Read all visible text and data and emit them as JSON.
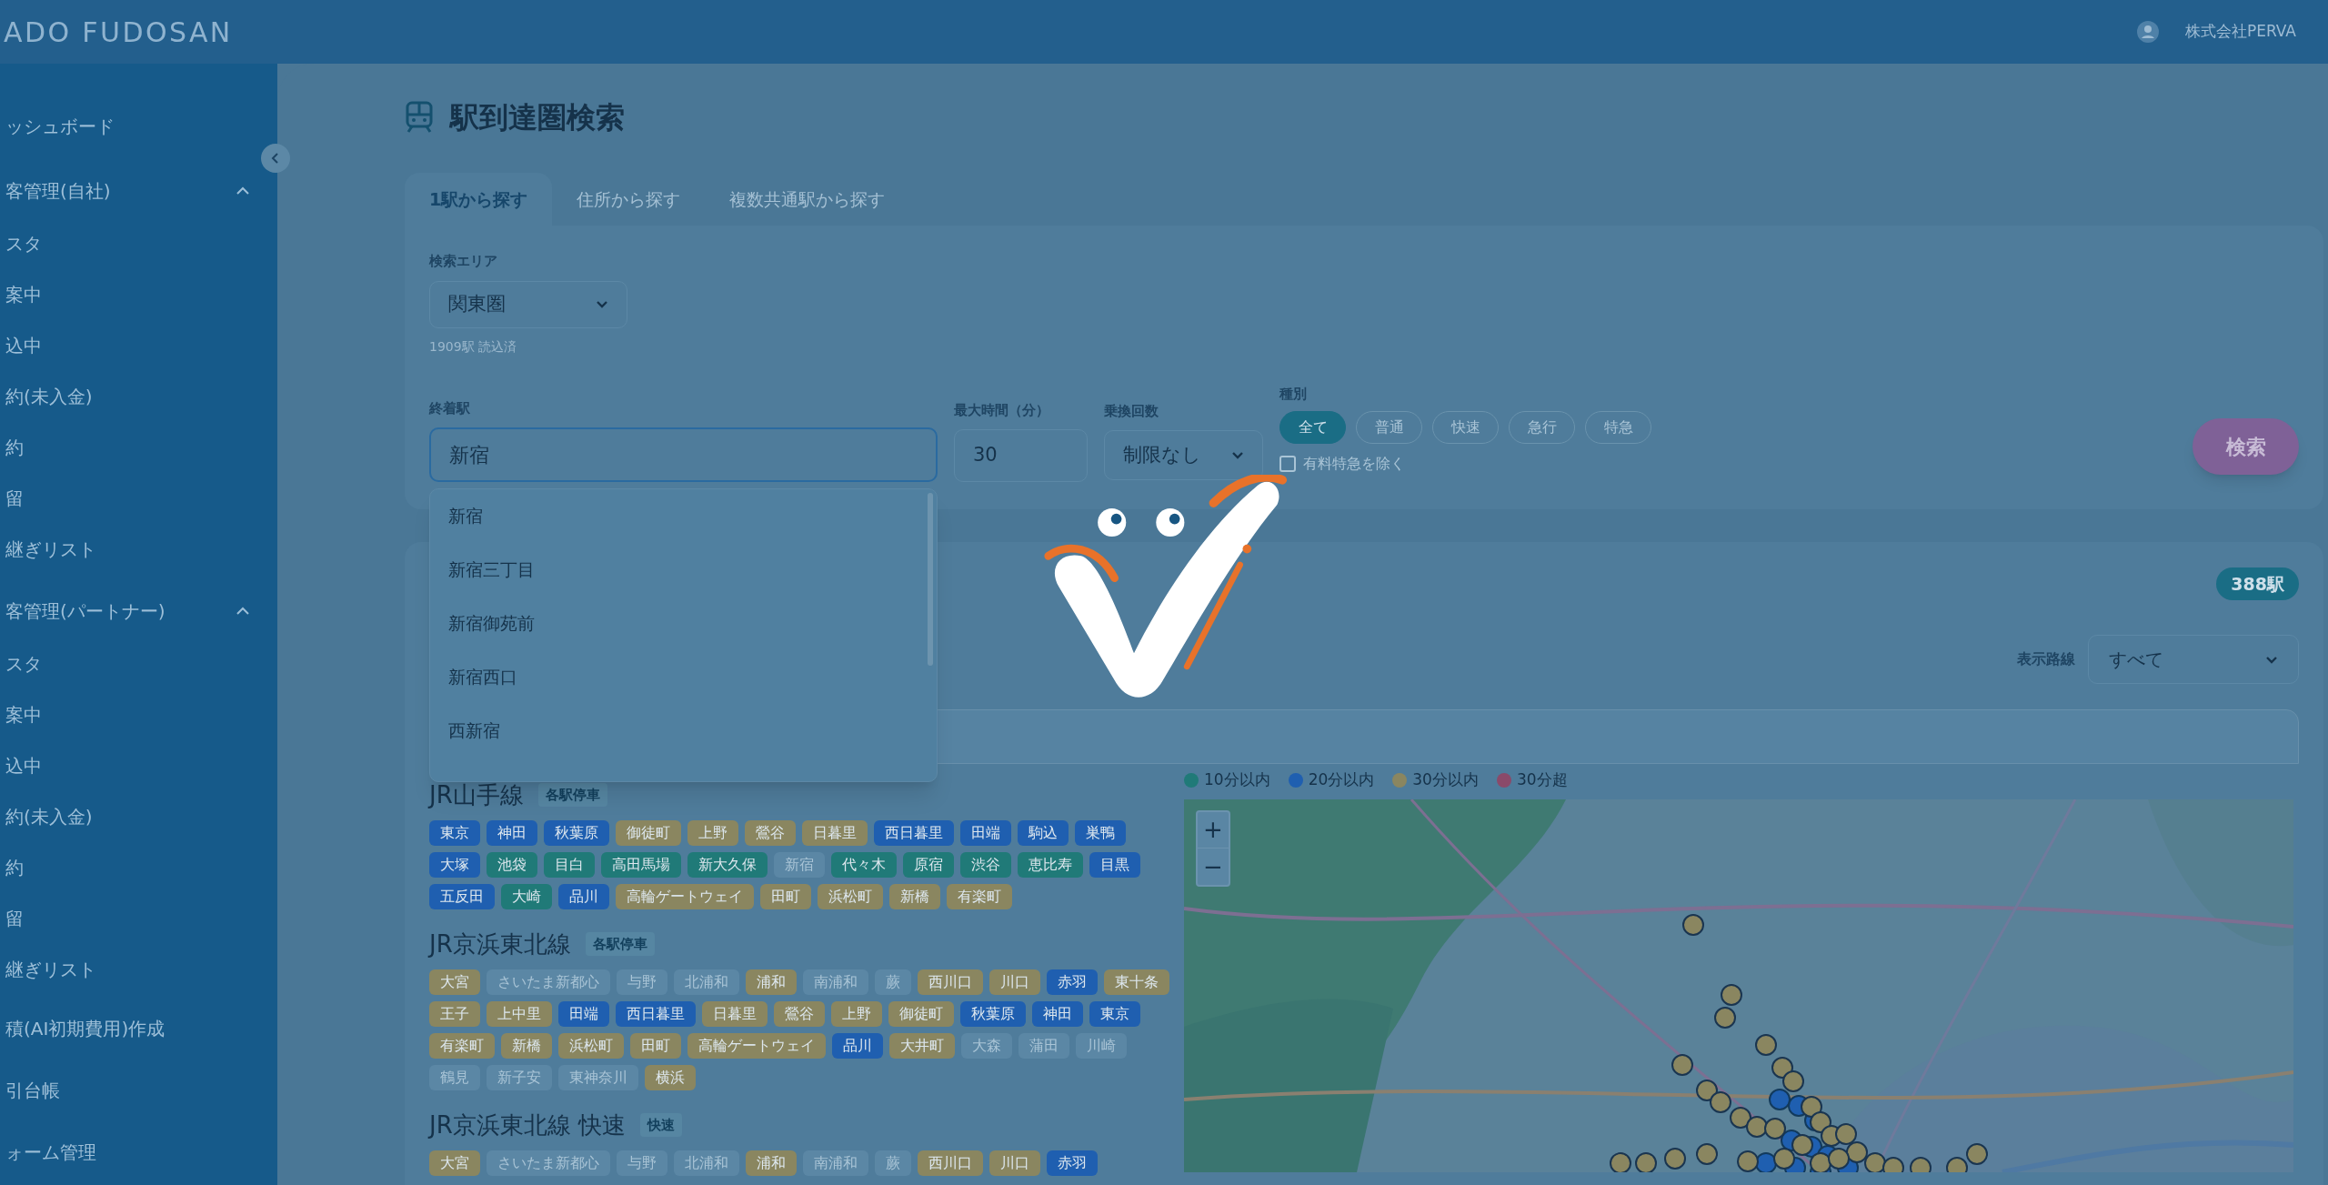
{
  "header": {
    "brand": "ADO FUDOSAN",
    "company": "株式会社PERVA"
  },
  "sidebar": {
    "items": [
      {
        "kind": "link",
        "label": "ッシュボード"
      },
      {
        "kind": "group",
        "label": "客管理(自社)",
        "expanded": true,
        "children": [
          {
            "label": "スタ"
          },
          {
            "label": "案中"
          },
          {
            "label": "込中"
          },
          {
            "label": "約(未入金)"
          },
          {
            "label": "約"
          },
          {
            "label": "留"
          },
          {
            "label": "継ぎリスト"
          }
        ]
      },
      {
        "kind": "group",
        "label": "客管理(パートナー)",
        "expanded": true,
        "children": [
          {
            "label": "スタ"
          },
          {
            "label": "案中"
          },
          {
            "label": "込中"
          },
          {
            "label": "約(未入金)"
          },
          {
            "label": "約"
          },
          {
            "label": "留"
          },
          {
            "label": "継ぎリスト"
          }
        ]
      },
      {
        "kind": "link",
        "label": "積(AI初期費用)作成"
      },
      {
        "kind": "link",
        "label": "引台帳"
      },
      {
        "kind": "link",
        "label": "ォーム管理"
      }
    ]
  },
  "page": {
    "title": "駅到達圏検索",
    "tabs": [
      {
        "label": "1駅から探す",
        "selected": true
      },
      {
        "label": "住所から探す",
        "selected": false
      },
      {
        "label": "複数共通駅から探す",
        "selected": false
      }
    ]
  },
  "search": {
    "area_label": "検索エリア",
    "area_value": "関東圏",
    "loaded_note": "1909駅 読込済",
    "station_label": "終着駅",
    "station_value": "新宿",
    "suggestions": [
      "新宿",
      "新宿三丁目",
      "新宿御苑前",
      "新宿西口",
      "西新宿"
    ],
    "max_time_label": "最大時間（分）",
    "max_time_value": "30",
    "transfers_label": "乗換回数",
    "transfers_value": "制限なし",
    "type_label": "種別",
    "types": [
      {
        "label": "全て",
        "selected": true
      },
      {
        "label": "普通",
        "selected": false
      },
      {
        "label": "快速",
        "selected": false
      },
      {
        "label": "急行",
        "selected": false
      },
      {
        "label": "特急",
        "selected": false
      }
    ],
    "exclude_paid": {
      "label": "有料特急を除く",
      "checked": false
    },
    "search_button": "検索"
  },
  "results": {
    "count": "388駅",
    "line_filter_label": "表示路線",
    "line_filter_value": "すべて",
    "lines": [
      {
        "name": "JR山手線",
        "badge": "各駅停車",
        "stations": [
          {
            "name": "東京",
            "reachable": true,
            "color": "#1f5fb0"
          },
          {
            "name": "神田",
            "reachable": true,
            "color": "#1f5fb0"
          },
          {
            "name": "秋葉原",
            "reachable": true,
            "color": "#1f5fb0"
          },
          {
            "name": "御徒町",
            "reachable": true,
            "color": "#8a8660"
          },
          {
            "name": "上野",
            "reachable": true,
            "color": "#8a8660"
          },
          {
            "name": "鶯谷",
            "reachable": true,
            "color": "#8a8660"
          },
          {
            "name": "日暮里",
            "reachable": true,
            "color": "#8a8660"
          },
          {
            "name": "西日暮里",
            "reachable": true,
            "color": "#1f5fb0"
          },
          {
            "name": "田端",
            "reachable": true,
            "color": "#1f5fb0"
          },
          {
            "name": "駒込",
            "reachable": true,
            "color": "#1f5fb0"
          },
          {
            "name": "巣鴨",
            "reachable": true,
            "color": "#1f5fb0"
          },
          {
            "name": "大塚",
            "reachable": true,
            "color": "#1f5fb0"
          },
          {
            "name": "池袋",
            "reachable": true,
            "color": "#207a78"
          },
          {
            "name": "目白",
            "reachable": true,
            "color": "#207a78"
          },
          {
            "name": "高田馬場",
            "reachable": true,
            "color": "#207a78"
          },
          {
            "name": "新大久保",
            "reachable": true,
            "color": "#207a78"
          },
          {
            "name": "新宿",
            "reachable": false
          },
          {
            "name": "代々木",
            "reachable": true,
            "color": "#207a78"
          },
          {
            "name": "原宿",
            "reachable": true,
            "color": "#207a78"
          },
          {
            "name": "渋谷",
            "reachable": true,
            "color": "#207a78"
          },
          {
            "name": "恵比寿",
            "reachable": true,
            "color": "#207a78"
          },
          {
            "name": "目黒",
            "reachable": true,
            "color": "#1f5fb0"
          },
          {
            "name": "五反田",
            "reachable": true,
            "color": "#1f5fb0"
          },
          {
            "name": "大崎",
            "reachable": true,
            "color": "#207a78"
          },
          {
            "name": "品川",
            "reachable": true,
            "color": "#1f5fb0"
          },
          {
            "name": "高輪ゲートウェイ",
            "reachable": true,
            "color": "#8a8660"
          },
          {
            "name": "田町",
            "reachable": true,
            "color": "#8a8660"
          },
          {
            "name": "浜松町",
            "reachable": true,
            "color": "#8a8660"
          },
          {
            "name": "新橋",
            "reachable": true,
            "color": "#8a8660"
          },
          {
            "name": "有楽町",
            "reachable": true,
            "color": "#8a8660"
          }
        ]
      },
      {
        "name": "JR京浜東北線",
        "badge": "各駅停車",
        "stations": [
          {
            "name": "大宮",
            "reachable": true,
            "color": "#8a8660"
          },
          {
            "name": "さいたま新都心",
            "reachable": false
          },
          {
            "name": "与野",
            "reachable": false
          },
          {
            "name": "北浦和",
            "reachable": false
          },
          {
            "name": "浦和",
            "reachable": true,
            "color": "#8a8660"
          },
          {
            "name": "南浦和",
            "reachable": false
          },
          {
            "name": "蕨",
            "reachable": false
          },
          {
            "name": "西川口",
            "reachable": true,
            "color": "#8a8660"
          },
          {
            "name": "川口",
            "reachable": true,
            "color": "#8a8660"
          },
          {
            "name": "赤羽",
            "reachable": true,
            "color": "#1f5fb0"
          },
          {
            "name": "東十条",
            "reachable": true,
            "color": "#8a8660"
          },
          {
            "name": "王子",
            "reachable": true,
            "color": "#8a8660"
          },
          {
            "name": "上中里",
            "reachable": true,
            "color": "#8a8660"
          },
          {
            "name": "田端",
            "reachable": true,
            "color": "#1f5fb0"
          },
          {
            "name": "西日暮里",
            "reachable": true,
            "color": "#1f5fb0"
          },
          {
            "name": "日暮里",
            "reachable": true,
            "color": "#8a8660"
          },
          {
            "name": "鶯谷",
            "reachable": true,
            "color": "#8a8660"
          },
          {
            "name": "上野",
            "reachable": true,
            "color": "#8a8660"
          },
          {
            "name": "御徒町",
            "reachable": true,
            "color": "#8a8660"
          },
          {
            "name": "秋葉原",
            "reachable": true,
            "color": "#1f5fb0"
          },
          {
            "name": "神田",
            "reachable": true,
            "color": "#1f5fb0"
          },
          {
            "name": "東京",
            "reachable": true,
            "color": "#1f5fb0"
          },
          {
            "name": "有楽町",
            "reachable": true,
            "color": "#8a8660"
          },
          {
            "name": "新橋",
            "reachable": true,
            "color": "#8a8660"
          },
          {
            "name": "浜松町",
            "reachable": true,
            "color": "#8a8660"
          },
          {
            "name": "田町",
            "reachable": true,
            "color": "#8a8660"
          },
          {
            "name": "高輪ゲートウェイ",
            "reachable": true,
            "color": "#8a8660"
          },
          {
            "name": "品川",
            "reachable": true,
            "color": "#1f5fb0"
          },
          {
            "name": "大井町",
            "reachable": true,
            "color": "#8a8660"
          },
          {
            "name": "大森",
            "reachable": false
          },
          {
            "name": "蒲田",
            "reachable": false
          },
          {
            "name": "川崎",
            "reachable": false
          },
          {
            "name": "鶴見",
            "reachable": false
          },
          {
            "name": "新子安",
            "reachable": false
          },
          {
            "name": "東神奈川",
            "reachable": false
          },
          {
            "name": "横浜",
            "reachable": true,
            "color": "#8a8660"
          }
        ]
      },
      {
        "name": "JR京浜東北線 快速",
        "badge": "快速",
        "stations": [
          {
            "name": "大宮",
            "reachable": true,
            "color": "#8a8660"
          },
          {
            "name": "さいたま新都心",
            "reachable": false
          },
          {
            "name": "与野",
            "reachable": false
          },
          {
            "name": "北浦和",
            "reachable": false
          },
          {
            "name": "浦和",
            "reachable": true,
            "color": "#8a8660"
          },
          {
            "name": "南浦和",
            "reachable": false
          },
          {
            "name": "蕨",
            "reachable": false
          },
          {
            "name": "西川口",
            "reachable": true,
            "color": "#8a8660"
          },
          {
            "name": "川口",
            "reachable": true,
            "color": "#8a8660"
          },
          {
            "name": "赤羽",
            "reachable": true,
            "color": "#1f5fb0"
          }
        ]
      }
    ],
    "legend": [
      {
        "label": "10分以内",
        "color": "#207a78"
      },
      {
        "label": "20分以内",
        "color": "#1f5fb0"
      },
      {
        "label": "30分以内",
        "color": "#8a8660"
      },
      {
        "label": "30分超",
        "color": "#8a4a6a"
      }
    ],
    "map": {
      "zoom_in": "+",
      "zoom_out": "−"
    }
  }
}
